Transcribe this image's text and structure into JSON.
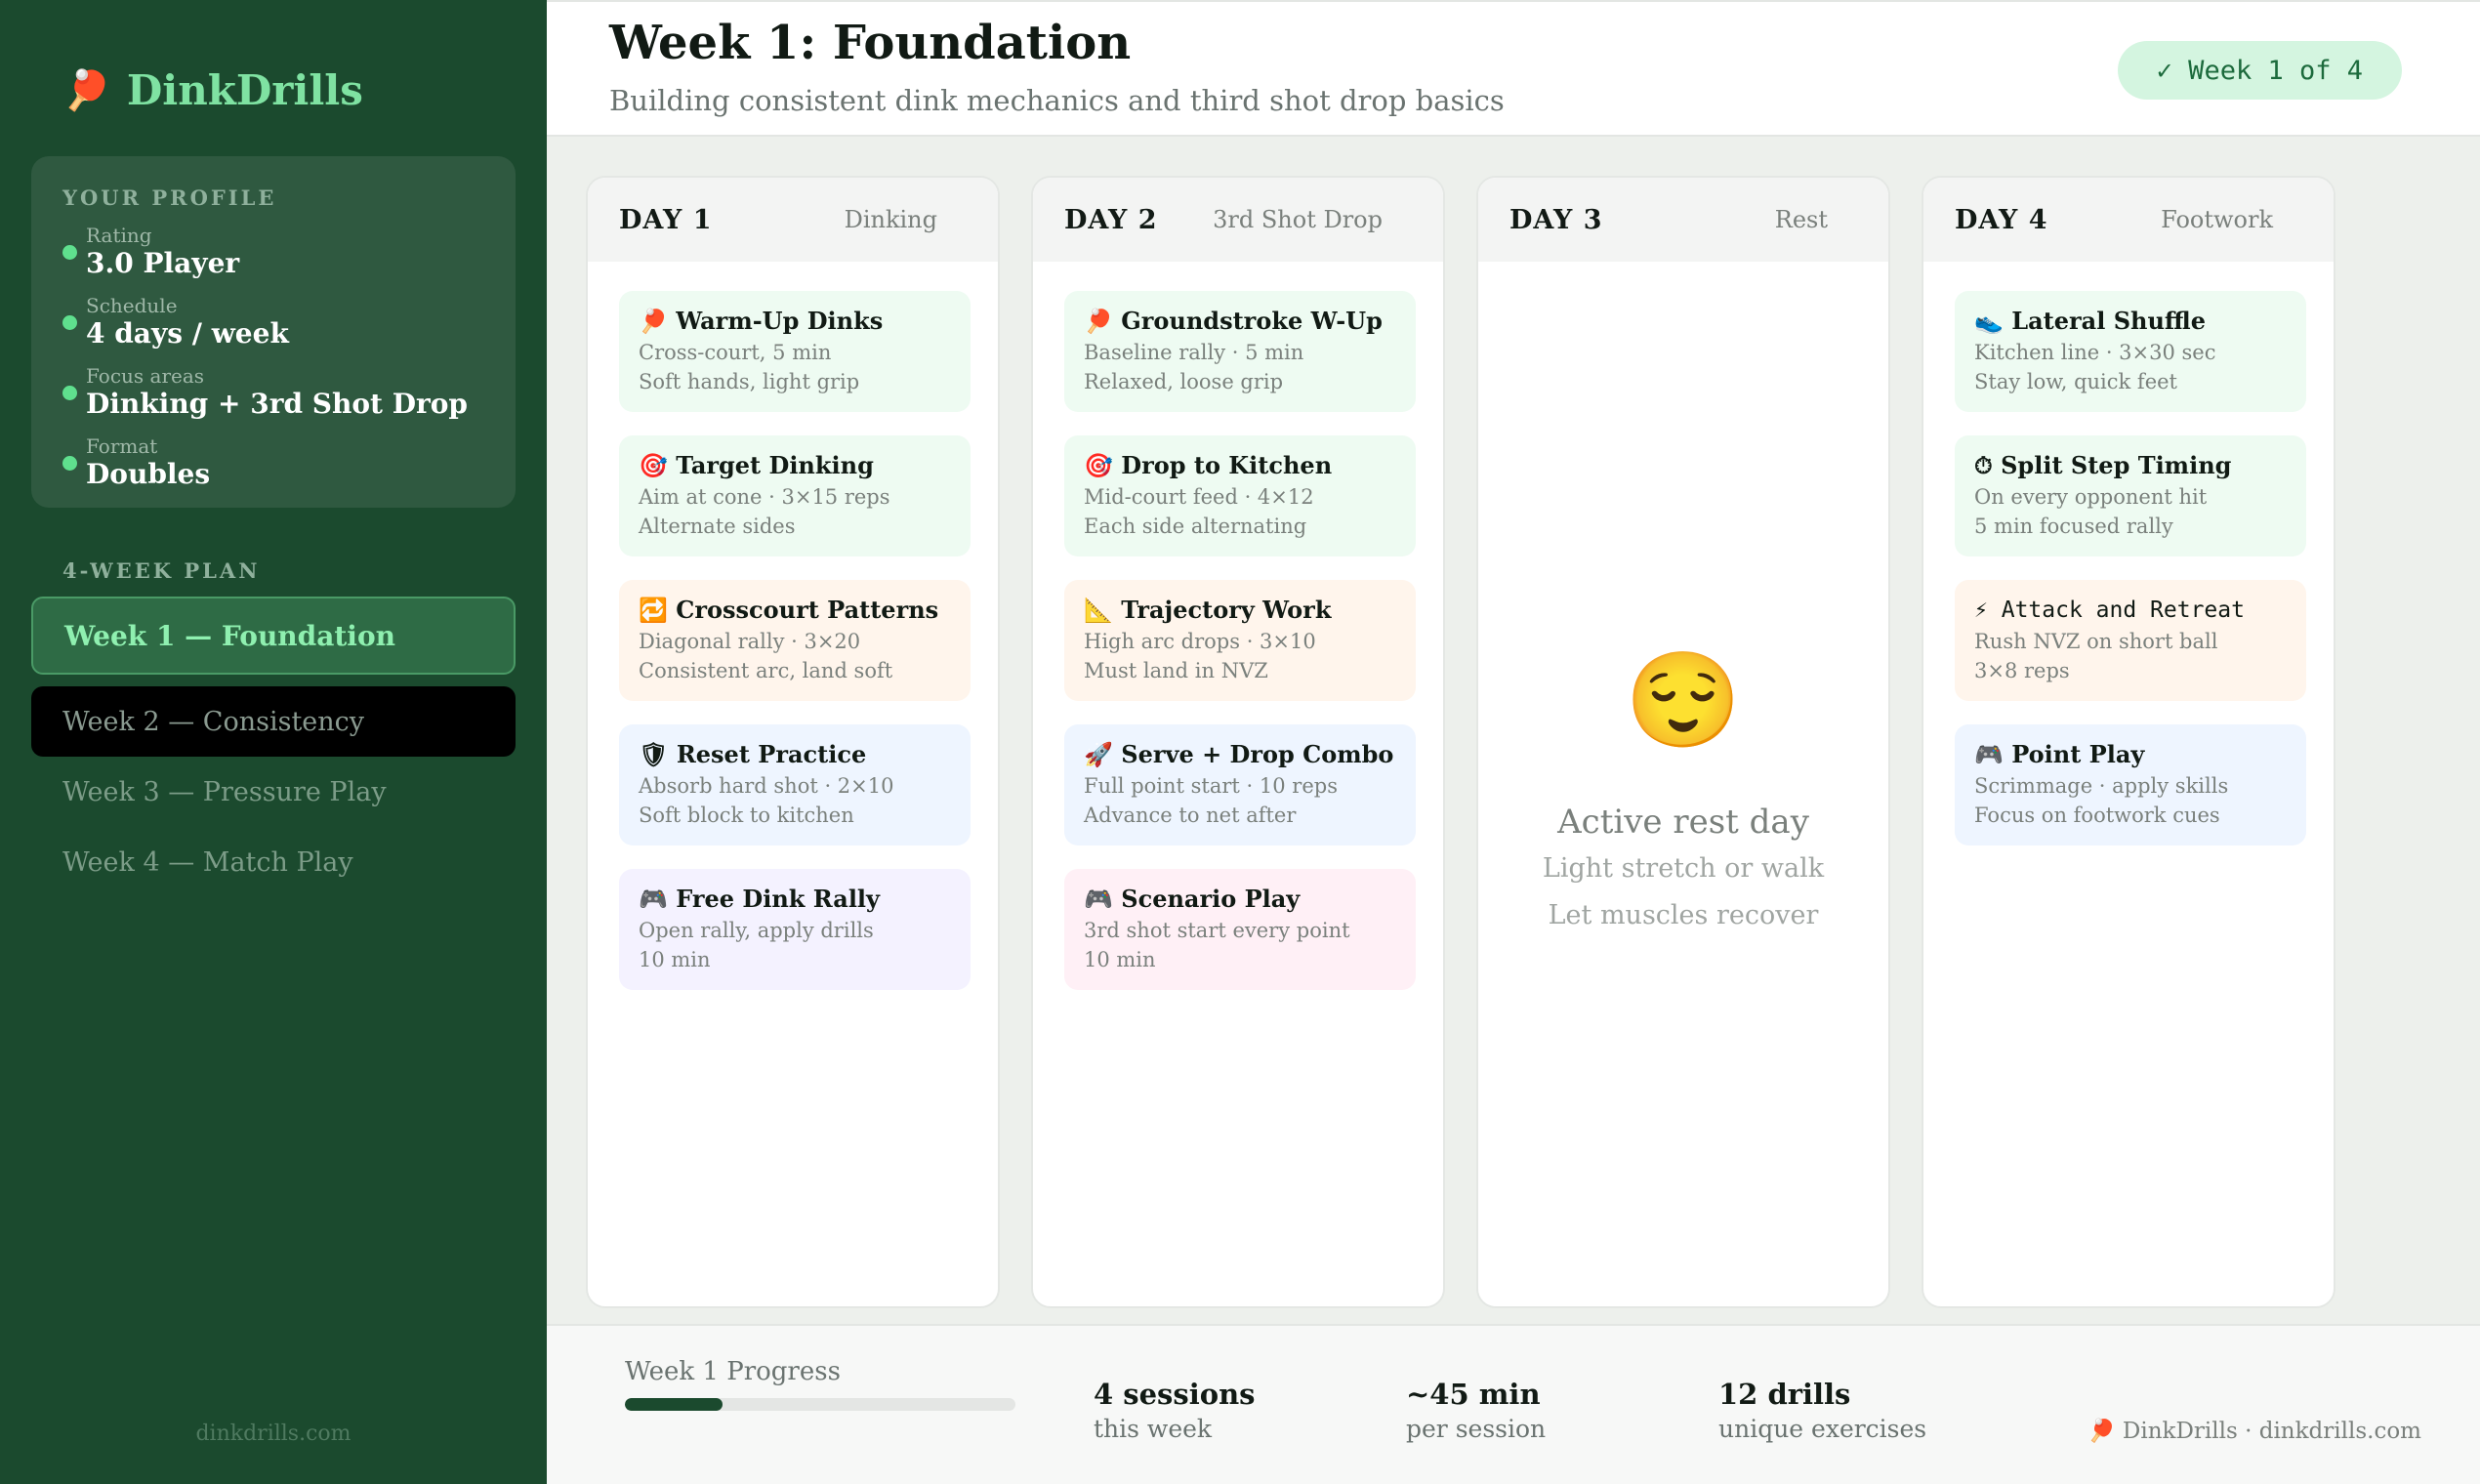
{
  "brand": {
    "icon": "🏓",
    "name": "DinkDrills"
  },
  "profile": {
    "heading": "YOUR PROFILE",
    "rows": [
      {
        "label": "Rating",
        "value": "3.0 Player"
      },
      {
        "label": "Schedule",
        "value": "4 days / week"
      },
      {
        "label": "Focus areas",
        "value": "Dinking + 3rd Shot Drop"
      },
      {
        "label": "Format",
        "value": "Doubles"
      }
    ]
  },
  "plan": {
    "heading": "4-WEEK PLAN",
    "weeks": [
      "Week 1 — Foundation",
      "Week 2 — Consistency",
      "Week 3 — Pressure Play",
      "Week 4 — Match Play"
    ]
  },
  "sidebar_footer": "dinkdrills.com",
  "header": {
    "title": "Week 1: Foundation",
    "subtitle": "Building consistent dink mechanics and third shot drop basics",
    "badge": "✓ Week 1 of 4"
  },
  "days": [
    {
      "num": "DAY 1",
      "focus": "Dinking",
      "drills": [
        {
          "icon": "🏓",
          "title": "Warm-Up Dinks",
          "l1": "Cross-court, 5 min",
          "l2": "Soft hands, light grip",
          "color": "#eefbf2"
        },
        {
          "icon": "🎯",
          "title": "Target Dinking",
          "l1": "Aim at cone · 3×15 reps",
          "l2": "Alternate sides",
          "color": "#eefbf2"
        },
        {
          "icon": "🔁",
          "title": "Crosscourt Patterns",
          "l1": "Diagonal rally · 3×20",
          "l2": "Consistent arc, land soft",
          "color": "#fff5ec"
        },
        {
          "icon": "🛡",
          "title": "Reset Practice",
          "l1": "Absorb hard shot · 2×10",
          "l2": "Soft block to kitchen",
          "color": "#eef5ff"
        },
        {
          "icon": "🎮",
          "title": "Free Dink Rally",
          "l1": "Open rally, apply drills",
          "l2": "10 min",
          "color": "#f4f2ff"
        }
      ]
    },
    {
      "num": "DAY 2",
      "focus": "3rd Shot Drop",
      "drills": [
        {
          "icon": "🏓",
          "title": "Groundstroke W-Up",
          "l1": "Baseline rally · 5 min",
          "l2": "Relaxed, loose grip",
          "color": "#eefbf2"
        },
        {
          "icon": "🎯",
          "title": "Drop to Kitchen",
          "l1": "Mid-court feed · 4×12",
          "l2": "Each side alternating",
          "color": "#eefbf2"
        },
        {
          "icon": "📐",
          "title": "Trajectory Work",
          "l1": "High arc drops · 3×10",
          "l2": "Must land in NVZ",
          "color": "#fff5ec"
        },
        {
          "icon": "🚀",
          "title": "Serve + Drop Combo",
          "l1": "Full point start · 10 reps",
          "l2": "Advance to net after",
          "color": "#eef5ff"
        },
        {
          "icon": "🎮",
          "title": "Scenario Play",
          "l1": "3rd shot start every point",
          "l2": "10 min",
          "color": "#fff0f6"
        }
      ]
    },
    {
      "num": "DAY 3",
      "focus": "Rest",
      "rest": {
        "emoji": "😌",
        "title": "Active rest day",
        "l1": "Light stretch or walk",
        "l2": "Let muscles recover"
      }
    },
    {
      "num": "DAY 4",
      "focus": "Footwork",
      "drills": [
        {
          "icon": "👟",
          "title": "Lateral Shuffle",
          "l1": "Kitchen line · 3×30 sec",
          "l2": "Stay low, quick feet",
          "color": "#eefbf2"
        },
        {
          "icon": "⏱",
          "title": "Split Step Timing",
          "l1": "On every opponent hit",
          "l2": "5 min focused rally",
          "color": "#eefbf2"
        },
        {
          "icon": "⚡",
          "title": "Attack and Retreat",
          "l1": "Rush NVZ on short ball",
          "l2": "3×8 reps",
          "color": "#fff5ec",
          "mono": true
        },
        {
          "icon": "🎮",
          "title": "Point Play",
          "l1": "Scrimmage · apply skills",
          "l2": "Focus on footwork cues",
          "color": "#eef5ff"
        }
      ]
    }
  ],
  "footer": {
    "progress_label": "Week 1 Progress",
    "progress_fraction": 0.25,
    "stats": [
      {
        "n": "4 sessions",
        "d": "this week"
      },
      {
        "n": "~45 min",
        "d": "per session"
      },
      {
        "n": "12 drills",
        "d": "unique exercises"
      }
    ],
    "credit": "🏓 DinkDrills · dinkdrills.com"
  }
}
